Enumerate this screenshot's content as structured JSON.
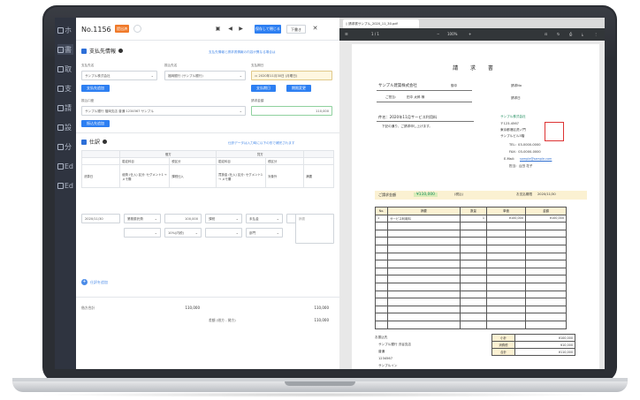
{
  "nav": {
    "items": [
      {
        "label": "ホ",
        "active": false
      },
      {
        "label": "書",
        "active": true
      },
      {
        "label": "取",
        "active": false
      },
      {
        "label": "支",
        "active": false
      },
      {
        "label": "請",
        "active": false
      },
      {
        "label": "設",
        "active": false
      },
      {
        "label": "分",
        "active": false
      },
      {
        "label": "Ed",
        "active": false
      },
      {
        "label": "Ed",
        "active": false
      }
    ]
  },
  "app": {
    "doc_number": "No.1156",
    "status_badge": "提出済",
    "toolbar": {
      "print_icon": "printer-icon",
      "prev": "◀",
      "next": "▶",
      "save_label": "保存して閉じる",
      "download_label": "下書き",
      "close_label": "✕"
    },
    "payee": {
      "title": "支払先情報",
      "help_link": "支払先情報と請求書情報の内容が異なる場合は",
      "payee_label": "支払先名",
      "payee_value": "サンプル株式会社",
      "bank_label": "振込先名",
      "bank_value": "福岡銀行 (サンプル銀行)",
      "date_label": "支払期日",
      "date_value": "2020年11月30日 (月曜日)",
      "add_payee_label": "支払先追加",
      "due_btn1": "支払期日",
      "due_btn2": "期限変更",
      "account_label": "振込口座",
      "account_value": "サンプル銀行 福岡支店 普通 1234567 サンプル",
      "amount_label": "請求金額",
      "amount_value": "110,000",
      "add_account_label": "振込先追加"
    },
    "journal": {
      "title": "仕訳",
      "help_link": "仕訳データは入力時に以下の形で補完されます",
      "header_debit": "借方",
      "header_credit": "貸方",
      "col_account": "勘定科目",
      "col_tax": "税区分",
      "col_amount": "金額",
      "col_memo": "摘要",
      "row_label": "決算日",
      "debit_account": "経費 (仕入) 区分: セグメント1 → メモ欄",
      "debit_tax": "課税仕入",
      "credit_account": "買掛金 (仕入) 区分: セグメント1 → メモ欄",
      "credit_tax": "対象外",
      "date_input": "2020/11/30",
      "account_input": "業務委託費",
      "amount_input": "100,000",
      "tax_input": "課税",
      "credit_input": "未払金",
      "credit_amount": "100,000",
      "memo_placeholder": "摘要",
      "tax_rate_input": "10%(内税)",
      "dept_input": "部門",
      "add_row_label": "仕訳を追加"
    },
    "summary": {
      "subtotal_label": "借方合計",
      "subtotal_value": "110,000",
      "total_value_a": "110,000",
      "total_label_b": "差額 (借方 - 貸方)",
      "total_value_b": "110,000"
    }
  },
  "viewer": {
    "tab_title": "請求書サンプル_2020_11_30.pdf",
    "page_info": "1 / 1",
    "zoom": "100%",
    "doc": {
      "title": "請 求 書",
      "to_company": "サンプル建築株式会社",
      "to_suffix": "御中",
      "attn_label": "ご担当：",
      "attn_value": "田中 太郎 様",
      "invoice_no_label": "請求No",
      "invoice_date_label": "請求日",
      "subject": "件名：2020年11月サービス利用料",
      "greeting": "下記の通り、ご請求申し上げます。",
      "issuer_name": "サンプル株式会社",
      "issuer_zip": "〒123-4567",
      "issuer_addr1": "東京都港区虎ノ門",
      "issuer_addr2": "サンプルビル5階",
      "tel": "TEL：03-0000-0000",
      "fax": "FAX：03-0000-0000",
      "email_label": "E-Mail：",
      "email": "sample@sample.com",
      "rep": "担当：山田 花子",
      "stamp": "サンプル株式会社",
      "amount_label": "ご請求金額",
      "amount": "¥110,000",
      "tax_note": "(税込)",
      "due_label": "お支払期限",
      "due_date": "2020/11/30",
      "table_headers": [
        "No.",
        "摘要",
        "数量",
        "単価",
        "金額"
      ],
      "table_rows": [
        [
          "1",
          "サービス利用料",
          "1",
          "¥100,000",
          "¥100,000"
        ],
        [
          "",
          "",
          "",
          "",
          ""
        ],
        [
          "",
          "",
          "",
          "",
          ""
        ],
        [
          "",
          "",
          "",
          "",
          ""
        ],
        [
          "",
          "",
          "",
          "",
          ""
        ],
        [
          "",
          "",
          "",
          "",
          ""
        ],
        [
          "",
          "",
          "",
          "",
          ""
        ],
        [
          "",
          "",
          "",
          "",
          ""
        ],
        [
          "",
          "",
          "",
          "",
          ""
        ],
        [
          "",
          "",
          "",
          "",
          ""
        ],
        [
          "",
          "",
          "",
          "",
          ""
        ],
        [
          "",
          "",
          "",
          "",
          ""
        ],
        [
          "",
          "",
          "",
          "",
          ""
        ],
        [
          "",
          "",
          "",
          "",
          ""
        ],
        [
          "",
          "",
          "",
          "",
          ""
        ]
      ],
      "totals": [
        {
          "label": "小計",
          "value": "¥100,000"
        },
        {
          "label": "消費税",
          "value": "¥10,000"
        },
        {
          "label": "合計",
          "value": "¥110,000"
        }
      ],
      "bank_title": "お振込先",
      "bank_name": "サンプル銀行 渋谷支店",
      "bank_type": "普通",
      "bank_number": "1234567",
      "bank_holder": "サンプルイン"
    }
  }
}
